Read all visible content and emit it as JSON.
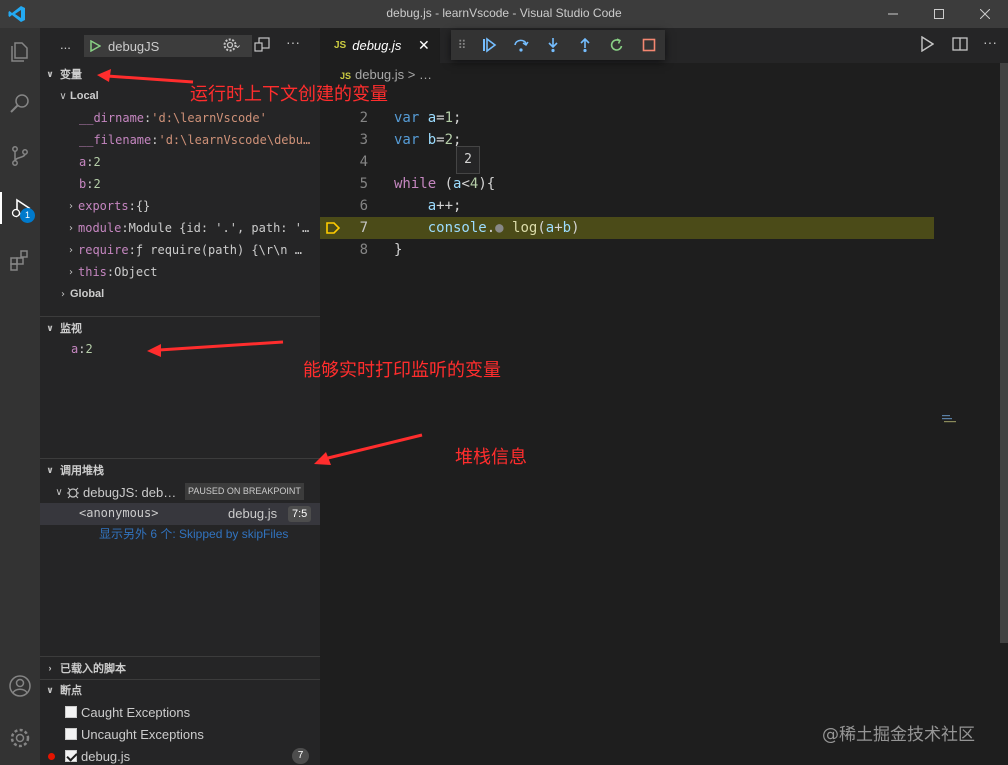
{
  "window": {
    "title": "debug.js - learnVscode - Visual Studio Code",
    "minimize_icon": "minimize-icon",
    "maximize_icon": "maximize-icon",
    "close_icon": "close-icon"
  },
  "activity_bar": {
    "icons": [
      "explorer-icon",
      "search-icon",
      "source-control-icon",
      "run-debug-icon",
      "extensions-icon",
      "account-icon",
      "settings-gear-icon"
    ],
    "debug_badge": "1"
  },
  "debug_toolbar": {
    "more": "...",
    "config_name": "debugJS"
  },
  "variables": {
    "header": "变量",
    "local_label": "Local",
    "items": [
      {
        "name": "__dirname",
        "sep": ": ",
        "value": "'d:\\learnVscode'"
      },
      {
        "name": "__filename",
        "sep": ": ",
        "value": "'d:\\learnVscode\\debu…"
      },
      {
        "name": "a",
        "sep": ": ",
        "value": "2"
      },
      {
        "name": "b",
        "sep": ": ",
        "value": "2"
      },
      {
        "name": "exports",
        "sep": ": ",
        "value": "{}"
      },
      {
        "name": "module",
        "sep": ": ",
        "value": "Module {id: '.', path: '…"
      },
      {
        "name": "require",
        "sep": ": ",
        "value": "ƒ require(path) {\\r\\n  …"
      },
      {
        "name": "this",
        "sep": ": ",
        "value": "Object"
      }
    ],
    "global_label": "Global"
  },
  "watch": {
    "header": "监视",
    "items": [
      {
        "name": "a",
        "sep": ": ",
        "value": "2"
      }
    ]
  },
  "call_stack": {
    "header": "调用堆栈",
    "session": "debugJS: deb…",
    "paused_label": "PAUSED ON BREAKPOINT",
    "frame_name": "<anonymous>",
    "frame_file": "debug.js",
    "frame_pos": "7:5",
    "skipped": "显示另外 6 个: Skipped by skipFiles"
  },
  "loaded_scripts": {
    "header": "已载入的脚本"
  },
  "breakpoints": {
    "header": "断点",
    "items": [
      {
        "label": "Caught Exceptions",
        "checked": false
      },
      {
        "label": "Uncaught Exceptions",
        "checked": false
      },
      {
        "label": "debug.js",
        "checked": true,
        "count": "7"
      }
    ]
  },
  "editor": {
    "tab_icon": "JS",
    "tab_name": "debug.js",
    "breadcrumb_file": "debug.js",
    "breadcrumb_sep": "> …",
    "hover_value": "2",
    "lines": [
      "2",
      "3",
      "4",
      "5",
      "6",
      "7",
      "8"
    ]
  },
  "annotations": {
    "context_vars": "运行时上下文创建的变量",
    "watch_vars": "能够实时打印监听的变量",
    "stack_info": "堆栈信息"
  },
  "watermark": "@稀土掘金技术社区",
  "colors": {
    "accent": "#007acc",
    "annotation_red": "#ff2d2d",
    "highlight_line": "#4b4b18"
  }
}
